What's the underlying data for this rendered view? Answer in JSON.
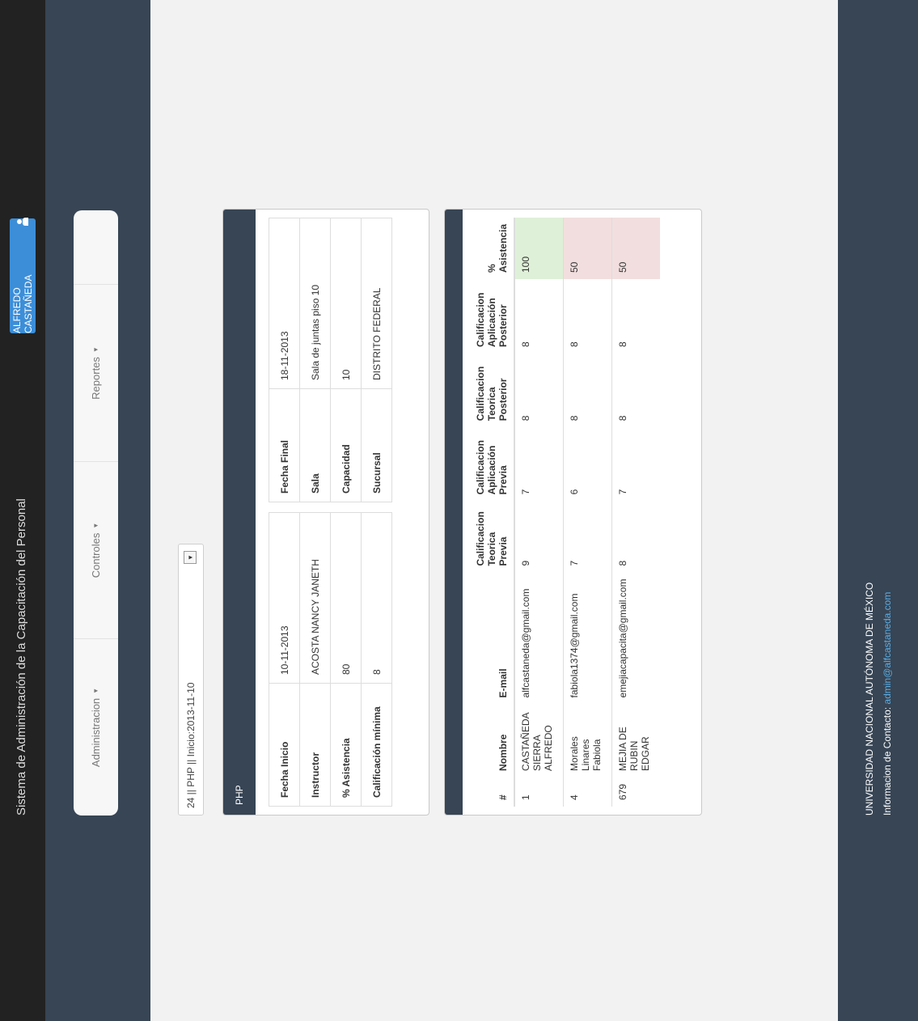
{
  "app": {
    "title": "Sistema de Administración de la Capacitación del Personal",
    "user_button": "ALFREDO CASTAÑEDA"
  },
  "nav": [
    "Administracion",
    "Controles",
    "Reportes"
  ],
  "course_select": {
    "value": "24 || PHP || Inicio:2013-11-10"
  },
  "course_panel": {
    "title": "PHP",
    "left_rows": [
      {
        "label": "Fecha Inicio",
        "value": "10-11-2013"
      },
      {
        "label": "Instructor",
        "value": "ACOSTA NANCY JANETH"
      },
      {
        "label": "% Asistencia",
        "value": "80"
      },
      {
        "label": "Calificación mínima",
        "value": "8"
      }
    ],
    "right_rows": [
      {
        "label": "Fecha Final",
        "value": "18-11-2013"
      },
      {
        "label": "Sala",
        "value": "Sala de juntas piso 10"
      },
      {
        "label": "Capacidad",
        "value": "10"
      },
      {
        "label": "Sucursal",
        "value": "DISTRITO FEDERAL"
      }
    ]
  },
  "students_table": {
    "headers": [
      "#",
      "Nombre",
      "E-mail",
      "Calificacion Teorica Previa",
      "Calificacion Aplicación Previa",
      "Calificacion Teorica Posterior",
      "Calificacion Aplicación Posterior",
      "% Asistencia"
    ],
    "rows": [
      [
        "1",
        "CASTAÑEDA SIERRA ALFREDO",
        "alfcastaneda@gmail.com",
        "9",
        "7",
        "8",
        "8",
        "100"
      ],
      [
        "4",
        "Morales Linares Fabiola",
        "fabiola1374@gmail.com",
        "7",
        "6",
        "8",
        "8",
        "50"
      ],
      [
        "679",
        "MEJIA DE RUBIN EDGAR",
        "emejiacapacita@gmail.com",
        "8",
        "7",
        "8",
        "8",
        "50"
      ]
    ],
    "status_colors": {
      "ok": "#dff0d8",
      "low": "#f2dede"
    }
  },
  "footer": {
    "line1": "UNIVERSIDAD NACIONAL AUTÓNOMA DE MÉXICO",
    "contact_label": "Informacion de Contacto:",
    "contact_link": "admin@alfcastaneda.com"
  }
}
